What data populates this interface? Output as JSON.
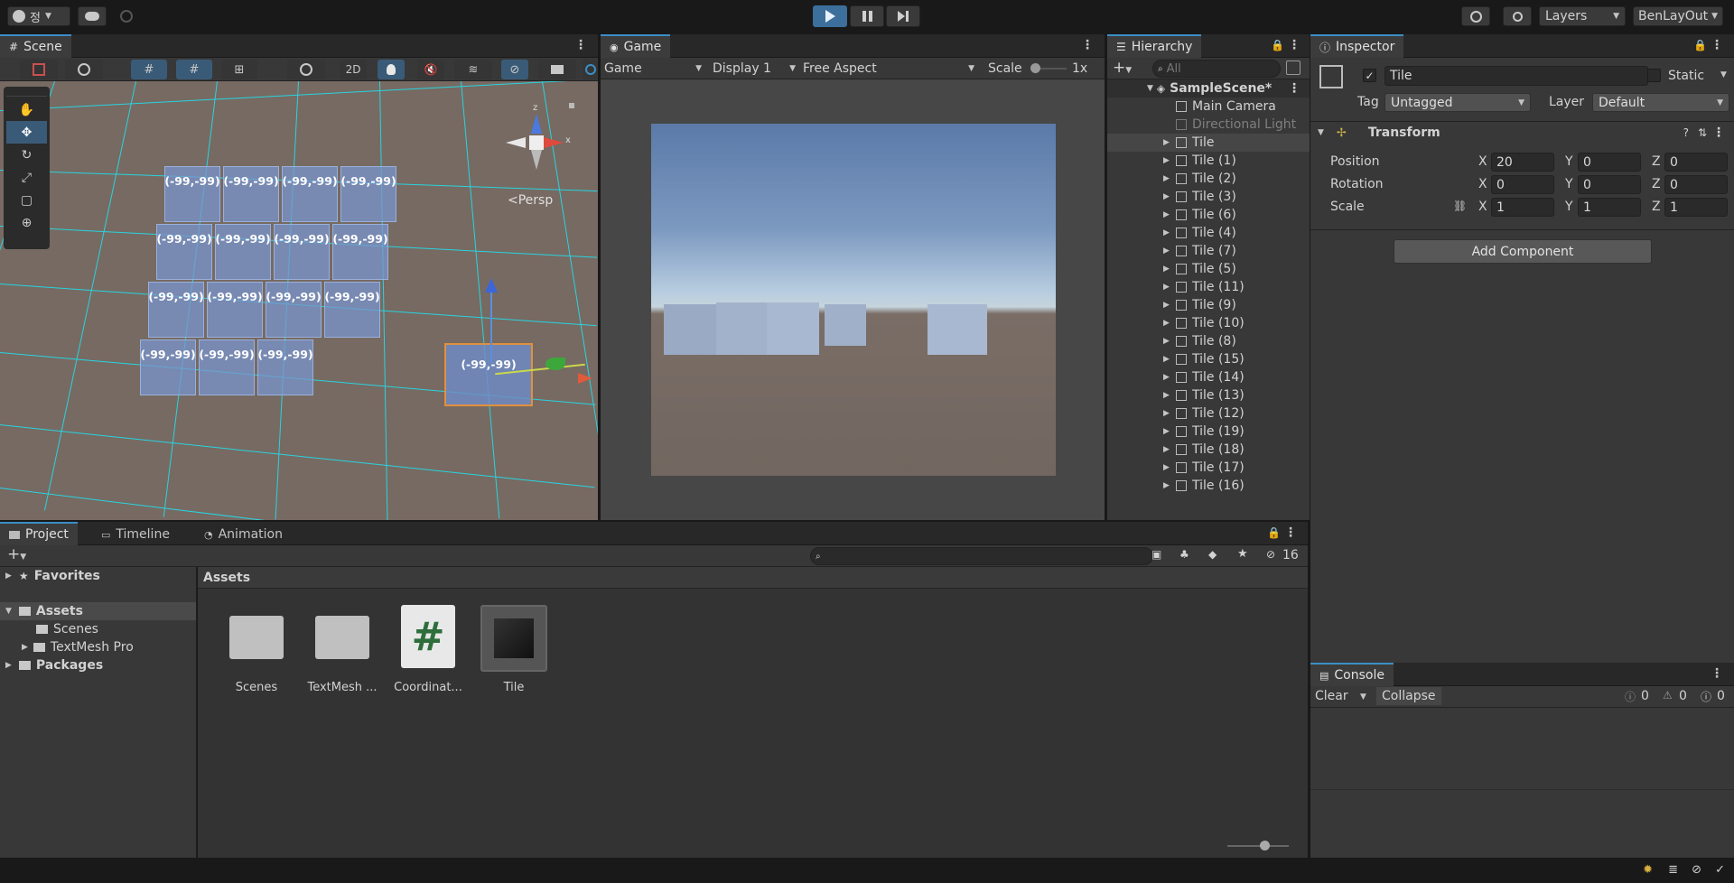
{
  "top": {
    "account_initial": "정",
    "layers_label": "Layers",
    "layout_label": "BenLayOut"
  },
  "scene": {
    "tab": "Scene",
    "mode_2d": "2D",
    "persp_label": "<Persp",
    "tile_label": "(-99,-99)",
    "grid_rows": [
      [
        "(-99,-99)",
        "(-99,-99)",
        "(-99,-99)",
        "(-99,-99)"
      ],
      [
        "(-99,-99)",
        "(-99,-99)",
        "(-99,-99)",
        "(-99,-99)"
      ],
      [
        "(-99,-99)",
        "(-99,-99)",
        "(-99,-99)",
        "(-99,-99)"
      ],
      [
        "(-99,-99)",
        "(-99,-99)",
        "(-99,-99)"
      ]
    ],
    "selected_label": "(-99,-99)",
    "gizmo_axes": {
      "x": "x",
      "z": "z"
    }
  },
  "game": {
    "tab": "Game",
    "view": "Game",
    "display": "Display 1",
    "aspect": "Free Aspect",
    "scale_label": "Scale",
    "scale_value": "1x"
  },
  "hierarchy": {
    "tab": "Hierarchy",
    "search_placeholder": "All",
    "scene_name": "SampleScene*",
    "items": [
      {
        "label": "Main Camera",
        "expand": false,
        "dim": false
      },
      {
        "label": "Directional Light",
        "expand": false,
        "dim": true
      },
      {
        "label": "Tile",
        "expand": true,
        "dim": false,
        "selected": true
      },
      {
        "label": "Tile (1)",
        "expand": true
      },
      {
        "label": "Tile (2)",
        "expand": true
      },
      {
        "label": "Tile (3)",
        "expand": true
      },
      {
        "label": "Tile (6)",
        "expand": true
      },
      {
        "label": "Tile (4)",
        "expand": true
      },
      {
        "label": "Tile (7)",
        "expand": true
      },
      {
        "label": "Tile (5)",
        "expand": true
      },
      {
        "label": "Tile (11)",
        "expand": true
      },
      {
        "label": "Tile (9)",
        "expand": true
      },
      {
        "label": "Tile (10)",
        "expand": true
      },
      {
        "label": "Tile (8)",
        "expand": true
      },
      {
        "label": "Tile (15)",
        "expand": true
      },
      {
        "label": "Tile (14)",
        "expand": true
      },
      {
        "label": "Tile (13)",
        "expand": true
      },
      {
        "label": "Tile (12)",
        "expand": true
      },
      {
        "label": "Tile (19)",
        "expand": true
      },
      {
        "label": "Tile (18)",
        "expand": true
      },
      {
        "label": "Tile (17)",
        "expand": true
      },
      {
        "label": "Tile (16)",
        "expand": true
      }
    ]
  },
  "inspector": {
    "tab": "Inspector",
    "object_name": "Tile",
    "static_label": "Static",
    "tag_label": "Tag",
    "tag_value": "Untagged",
    "layer_label": "Layer",
    "layer_value": "Default",
    "transform_title": "Transform",
    "position_label": "Position",
    "rotation_label": "Rotation",
    "scale_label": "Scale",
    "axis_x": "X",
    "axis_y": "Y",
    "axis_z": "Z",
    "position": {
      "x": "20",
      "y": "0",
      "z": "0"
    },
    "rotation": {
      "x": "0",
      "y": "0",
      "z": "0"
    },
    "scale": {
      "x": "1",
      "y": "1",
      "z": "1"
    },
    "add_component": "Add Component"
  },
  "console": {
    "tab": "Console",
    "clear": "Clear",
    "collapse": "Collapse",
    "info_count": "0",
    "warn_count": "0",
    "error_count": "0"
  },
  "project": {
    "tabs": [
      "Project",
      "Timeline",
      "Animation"
    ],
    "hidden_count": "16",
    "favorites": "Favorites",
    "assets": "Assets",
    "scenes": "Scenes",
    "textmesh": "TextMesh Pro",
    "packages": "Packages",
    "breadcrumb": "Assets",
    "files": [
      {
        "label": "Scenes",
        "kind": "folder"
      },
      {
        "label": "TextMesh ...",
        "kind": "folder"
      },
      {
        "label": "Coordinat...",
        "kind": "script"
      },
      {
        "label": "Tile",
        "kind": "prefab"
      }
    ]
  },
  "colors": {
    "accent": "#3c8ec5",
    "grid": "#28d4e0",
    "tile": "#7896cd",
    "sky_top": "#5c7aa6",
    "ground": "#716760"
  }
}
